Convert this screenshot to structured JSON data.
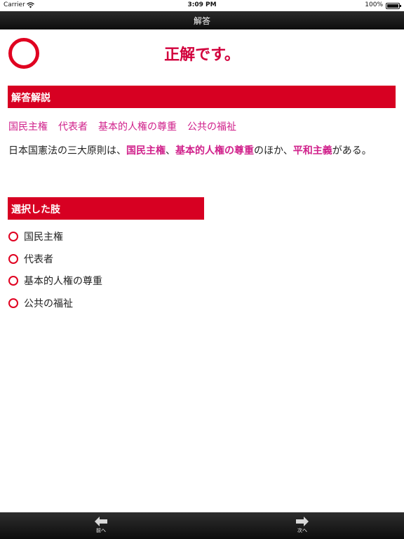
{
  "status_bar": {
    "carrier": "Carrier",
    "time": "3:09 PM",
    "battery": "100%"
  },
  "nav": {
    "title": "解答"
  },
  "result": {
    "text": "正解です。"
  },
  "explanation": {
    "header": "解答解説",
    "keywords": [
      "国民主権",
      "代表者",
      "基本的人権の尊重",
      "公共の福祉"
    ],
    "text_parts": [
      {
        "text": "日本国憲法の三大原則は、",
        "highlight": false
      },
      {
        "text": "国民主権",
        "highlight": true
      },
      {
        "text": "、",
        "highlight": false
      },
      {
        "text": "基本的人権の尊重",
        "highlight": true
      },
      {
        "text": "のほか、",
        "highlight": false
      },
      {
        "text": "平和主義",
        "highlight": true
      },
      {
        "text": "がある。",
        "highlight": false
      }
    ]
  },
  "choices": {
    "header": "選択した肢",
    "items": [
      "国民主権",
      "代表者",
      "基本的人権の尊重",
      "公共の福祉"
    ]
  },
  "toolbar": {
    "prev_label": "前へ",
    "next_label": "次へ"
  },
  "colors": {
    "accent_red": "#d70022",
    "keyword_magenta": "#d0218b",
    "result_red": "#d2003c"
  },
  "icons": {
    "prev": "arrow-left-icon",
    "next": "arrow-right-icon",
    "result": "circle-correct-icon",
    "choice": "circle-marker-icon"
  }
}
